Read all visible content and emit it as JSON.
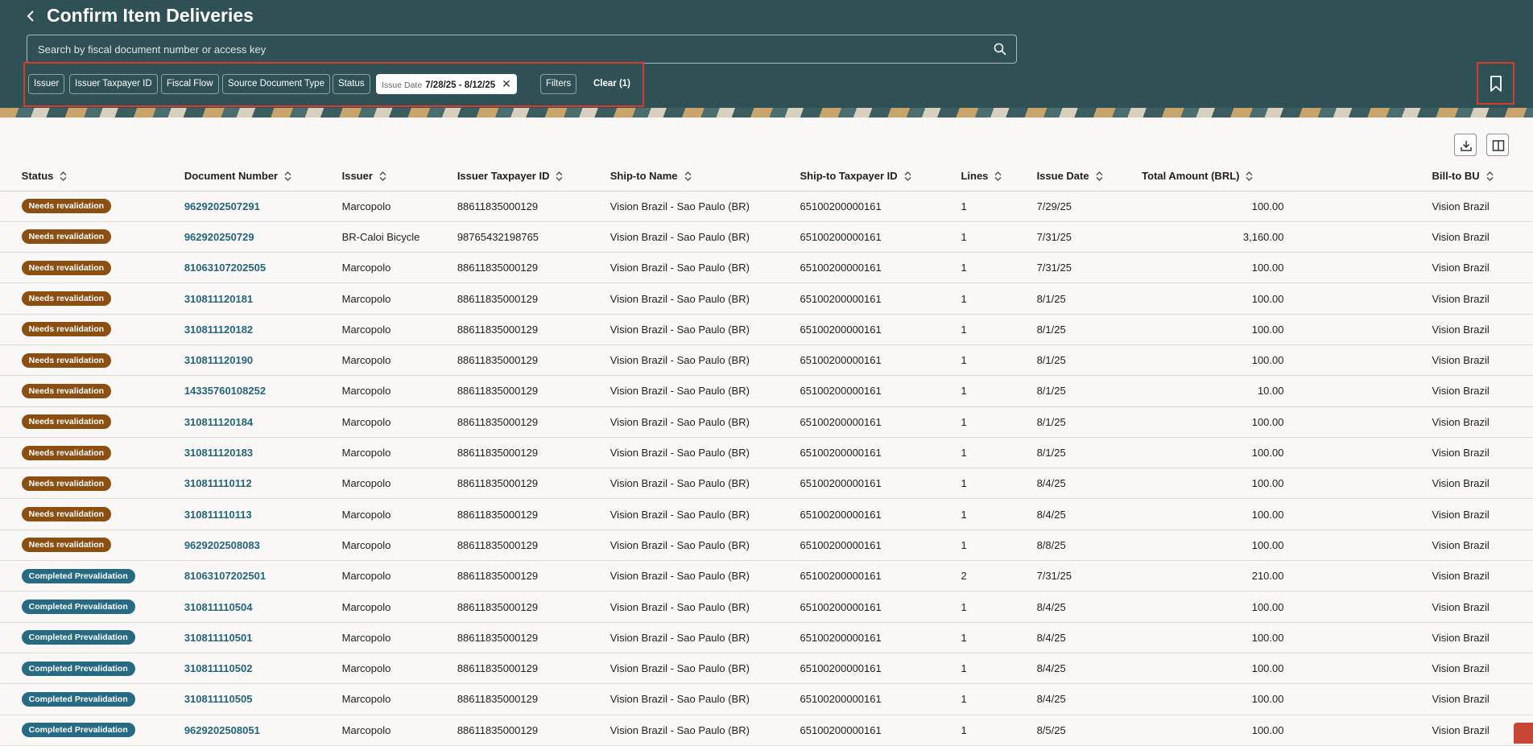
{
  "header": {
    "title": "Confirm Item Deliveries",
    "search_placeholder": "Search by fiscal document number or access key",
    "filters": [
      "Issuer",
      "Issuer Taxpayer ID",
      "Fiscal Flow",
      "Source Document Type",
      "Status"
    ],
    "active_filter": {
      "label": "Issue Date",
      "value": "7/28/25 - 8/12/25"
    },
    "filters_button": "Filters",
    "clear_button": "Clear (1)"
  },
  "table": {
    "columns": [
      "Status",
      "Document Number",
      "Issuer",
      "Issuer Taxpayer ID",
      "Ship-to Name",
      "Ship-to Taxpayer ID",
      "Lines",
      "Issue Date",
      "Total Amount (BRL)",
      "Bill-to BU"
    ],
    "rows": [
      [
        "Needs revalidation",
        "9629202507291",
        "Marcopolo",
        "88611835000129",
        "Vision Brazil - Sao Paulo (BR)",
        "65100200000161",
        "1",
        "7/29/25",
        "100.00",
        "Vision Brazil"
      ],
      [
        "Needs revalidation",
        "962920250729",
        "BR-Caloi Bicycle",
        "98765432198765",
        "Vision Brazil - Sao Paulo (BR)",
        "65100200000161",
        "1",
        "7/31/25",
        "3,160.00",
        "Vision Brazil"
      ],
      [
        "Needs revalidation",
        "81063107202505",
        "Marcopolo",
        "88611835000129",
        "Vision Brazil - Sao Paulo (BR)",
        "65100200000161",
        "1",
        "7/31/25",
        "100.00",
        "Vision Brazil"
      ],
      [
        "Needs revalidation",
        "310811120181",
        "Marcopolo",
        "88611835000129",
        "Vision Brazil - Sao Paulo (BR)",
        "65100200000161",
        "1",
        "8/1/25",
        "100.00",
        "Vision Brazil"
      ],
      [
        "Needs revalidation",
        "310811120182",
        "Marcopolo",
        "88611835000129",
        "Vision Brazil - Sao Paulo (BR)",
        "65100200000161",
        "1",
        "8/1/25",
        "100.00",
        "Vision Brazil"
      ],
      [
        "Needs revalidation",
        "310811120190",
        "Marcopolo",
        "88611835000129",
        "Vision Brazil - Sao Paulo (BR)",
        "65100200000161",
        "1",
        "8/1/25",
        "100.00",
        "Vision Brazil"
      ],
      [
        "Needs revalidation",
        "14335760108252",
        "Marcopolo",
        "88611835000129",
        "Vision Brazil - Sao Paulo (BR)",
        "65100200000161",
        "1",
        "8/1/25",
        "10.00",
        "Vision Brazil"
      ],
      [
        "Needs revalidation",
        "310811120184",
        "Marcopolo",
        "88611835000129",
        "Vision Brazil - Sao Paulo (BR)",
        "65100200000161",
        "1",
        "8/1/25",
        "100.00",
        "Vision Brazil"
      ],
      [
        "Needs revalidation",
        "310811120183",
        "Marcopolo",
        "88611835000129",
        "Vision Brazil - Sao Paulo (BR)",
        "65100200000161",
        "1",
        "8/1/25",
        "100.00",
        "Vision Brazil"
      ],
      [
        "Needs revalidation",
        "310811110112",
        "Marcopolo",
        "88611835000129",
        "Vision Brazil - Sao Paulo (BR)",
        "65100200000161",
        "1",
        "8/4/25",
        "100.00",
        "Vision Brazil"
      ],
      [
        "Needs revalidation",
        "310811110113",
        "Marcopolo",
        "88611835000129",
        "Vision Brazil - Sao Paulo (BR)",
        "65100200000161",
        "1",
        "8/4/25",
        "100.00",
        "Vision Brazil"
      ],
      [
        "Needs revalidation",
        "9629202508083",
        "Marcopolo",
        "88611835000129",
        "Vision Brazil - Sao Paulo (BR)",
        "65100200000161",
        "1",
        "8/8/25",
        "100.00",
        "Vision Brazil"
      ],
      [
        "Completed Prevalidation",
        "81063107202501",
        "Marcopolo",
        "88611835000129",
        "Vision Brazil - Sao Paulo (BR)",
        "65100200000161",
        "2",
        "7/31/25",
        "210.00",
        "Vision Brazil"
      ],
      [
        "Completed Prevalidation",
        "310811110504",
        "Marcopolo",
        "88611835000129",
        "Vision Brazil - Sao Paulo (BR)",
        "65100200000161",
        "1",
        "8/4/25",
        "100.00",
        "Vision Brazil"
      ],
      [
        "Completed Prevalidation",
        "310811110501",
        "Marcopolo",
        "88611835000129",
        "Vision Brazil - Sao Paulo (BR)",
        "65100200000161",
        "1",
        "8/4/25",
        "100.00",
        "Vision Brazil"
      ],
      [
        "Completed Prevalidation",
        "310811110502",
        "Marcopolo",
        "88611835000129",
        "Vision Brazil - Sao Paulo (BR)",
        "65100200000161",
        "1",
        "8/4/25",
        "100.00",
        "Vision Brazil"
      ],
      [
        "Completed Prevalidation",
        "310811110505",
        "Marcopolo",
        "88611835000129",
        "Vision Brazil - Sao Paulo (BR)",
        "65100200000161",
        "1",
        "8/4/25",
        "100.00",
        "Vision Brazil"
      ],
      [
        "Completed Prevalidation",
        "9629202508051",
        "Marcopolo",
        "88611835000129",
        "Vision Brazil - Sao Paulo (BR)",
        "65100200000161",
        "1",
        "8/5/25",
        "100.00",
        "Vision Brazil"
      ]
    ]
  },
  "icons": {
    "back": "chevron-left-icon",
    "search": "search-icon",
    "bookmark": "bookmark-icon",
    "download": "download-icon",
    "columns": "columns-icon",
    "clear": "close-icon"
  },
  "colors": {
    "header_bg": "#2f5054",
    "needs_revalidation": "#8b4f12",
    "completed_prevalidation": "#276a83",
    "link": "#23647c",
    "highlight": "#d93b2b"
  }
}
